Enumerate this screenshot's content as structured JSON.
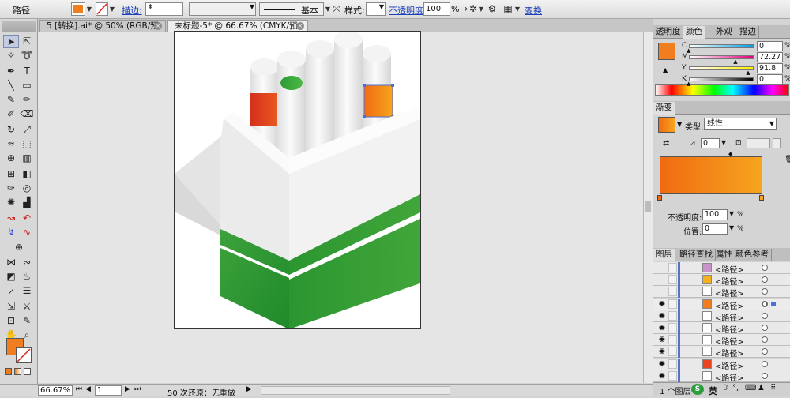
{
  "control_bar": {
    "selection_type": "路径",
    "fill_color": "#f07d1e",
    "stroke_label": "描边:",
    "stroke_weight": "",
    "brush_definition": "基本",
    "style_label": "样式:",
    "opacity_label": "不透明度",
    "opacity_value": "100",
    "opacity_unit": "%",
    "transform_label": "变换"
  },
  "tabs": [
    {
      "label": "5 [转换].ai* @ 50% (RGB/预览)",
      "close": "×"
    },
    {
      "label": "未标题-5* @ 66.67% (CMYK/预览)",
      "close": "×"
    }
  ],
  "status": {
    "zoom": "66.67%",
    "artboard_nav": "1",
    "message": "50 次还原：无重做",
    "arrow": "▶"
  },
  "color_panel": {
    "tabs": [
      "透明度",
      "颜色",
      "外观",
      "描边"
    ],
    "active_tab": "颜色",
    "sliders": [
      {
        "label": "C",
        "value": "0",
        "position": 0,
        "gradient": [
          "#ffffff",
          "#00a0e9"
        ]
      },
      {
        "label": "M",
        "value": "72.27",
        "position": 0.7227,
        "gradient": [
          "#ffffff",
          "#e4007f"
        ]
      },
      {
        "label": "Y",
        "value": "91.8",
        "position": 0.918,
        "gradient": [
          "#ffffff",
          "#fff100"
        ]
      },
      {
        "label": "K",
        "value": "0",
        "position": 0,
        "gradient": [
          "#ffffff",
          "#000000"
        ]
      }
    ],
    "unit": "%",
    "swatch": "#f07d1e"
  },
  "gradient_panel": {
    "title": "渐变",
    "type_label": "类型:",
    "type_value": "线性",
    "angle_value": "0",
    "aspect_value": "",
    "colors": [
      "#f06b12",
      "#f7a51e"
    ],
    "opacity_label": "不透明度:",
    "opacity_value": "100",
    "location_label": "位置:",
    "location_value": "0",
    "unit": "%"
  },
  "layers_panel": {
    "tabs": [
      "图层",
      "路径查找",
      "属性",
      "颜色参考"
    ],
    "active_tab": "图层",
    "rows": [
      {
        "name": "<路径>",
        "thumb": "#c893c8",
        "visible": false,
        "selected": false
      },
      {
        "name": "<路径>",
        "thumb": "#f4b21f",
        "visible": false,
        "selected": false
      },
      {
        "name": "<路径>",
        "thumb": "#ffffff",
        "visible": false,
        "selected": false
      },
      {
        "name": "<路径>",
        "thumb": "#f07d1e",
        "visible": true,
        "selected": true
      },
      {
        "name": "<路径>",
        "thumb": "#ffffff",
        "visible": true,
        "selected": false
      },
      {
        "name": "<路径>",
        "thumb": "#ffffff",
        "visible": true,
        "selected": false
      },
      {
        "name": "<路径>",
        "thumb": "#ffffff",
        "visible": true,
        "selected": false
      },
      {
        "name": "<路径>",
        "thumb": "#ffffff",
        "visible": true,
        "selected": false
      },
      {
        "name": "<路径>",
        "thumb": "#e84520",
        "visible": true,
        "selected": false
      },
      {
        "name": "<路径>",
        "thumb": "#ffffff",
        "visible": true,
        "selected": false
      }
    ],
    "footer": "1 个图层",
    "ime_label": "英"
  }
}
